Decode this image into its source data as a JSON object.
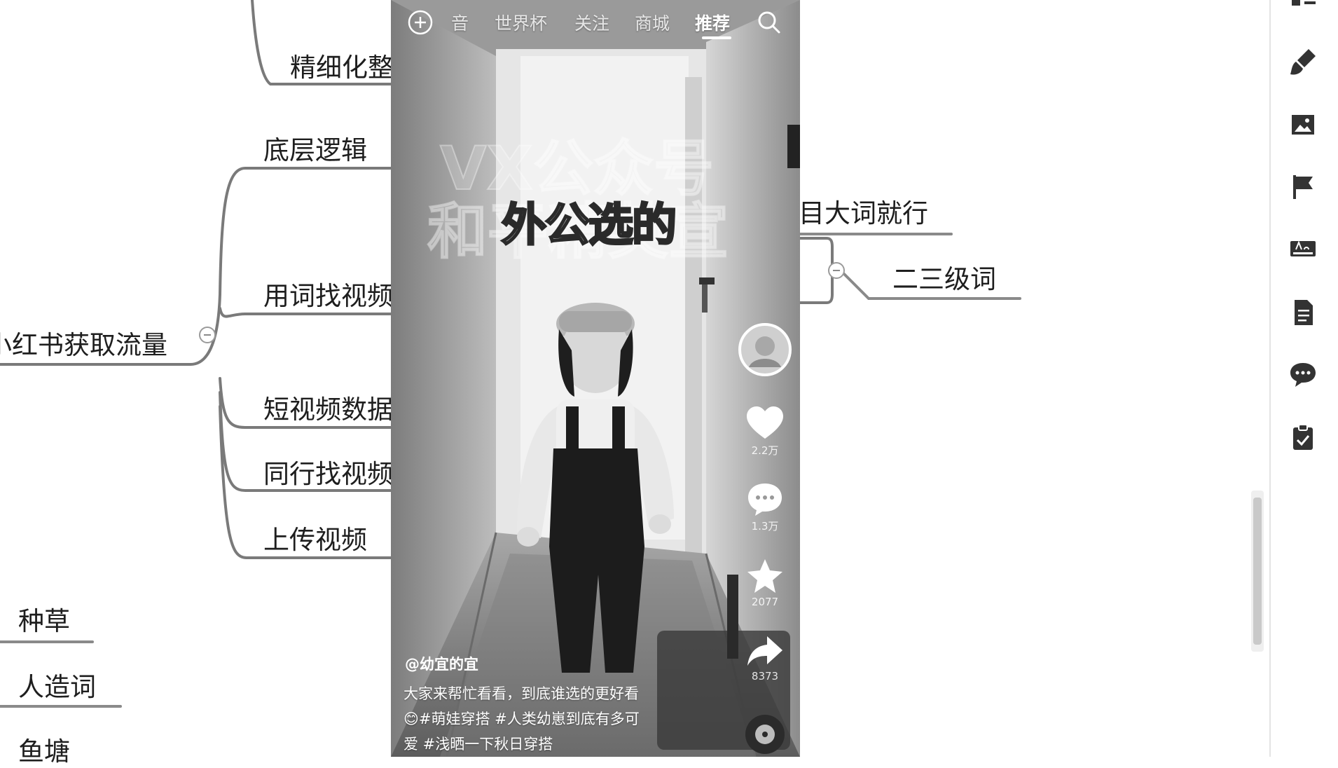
{
  "mindmap": {
    "nodes": {
      "n_finetune": "精细化整",
      "n_logic": "底层逻辑",
      "n_findwords": "用词找视频",
      "n_root": "小红书获取流量",
      "n_shortdata": "短视频数据",
      "n_peer": "同行找视频",
      "n_upload": "上传视频",
      "n_seed": "种草",
      "n_artificial": "人造词",
      "n_pond": "鱼塘",
      "n_bigword": "目大词就行",
      "n_secondary": "二三级词"
    }
  },
  "phone": {
    "tabs": [
      "音",
      "世界杯",
      "关注",
      "商城",
      "推荐"
    ],
    "active_tab": "推荐",
    "caption": "外公选的",
    "watermark_line1": "VX公众号",
    "watermark_line2": "和平精英宣",
    "actions": {
      "like_count": "2.2万",
      "comment_count": "1.3万",
      "favorite_count": "2077",
      "share_count": "8373"
    },
    "author": "@幼宜的宜",
    "description_lines": [
      "大家来帮忙看看，到底谁选的更好看",
      "😊#萌娃穿搭 #人类幼崽到底有多可",
      "爱 #浅晒一下秋日穿搭"
    ]
  },
  "toolbar": {
    "icons": [
      "structure-icon",
      "paint-brush-icon",
      "image-icon",
      "flag-icon",
      "text-style-icon",
      "note-icon",
      "comment-icon",
      "task-icon"
    ]
  }
}
